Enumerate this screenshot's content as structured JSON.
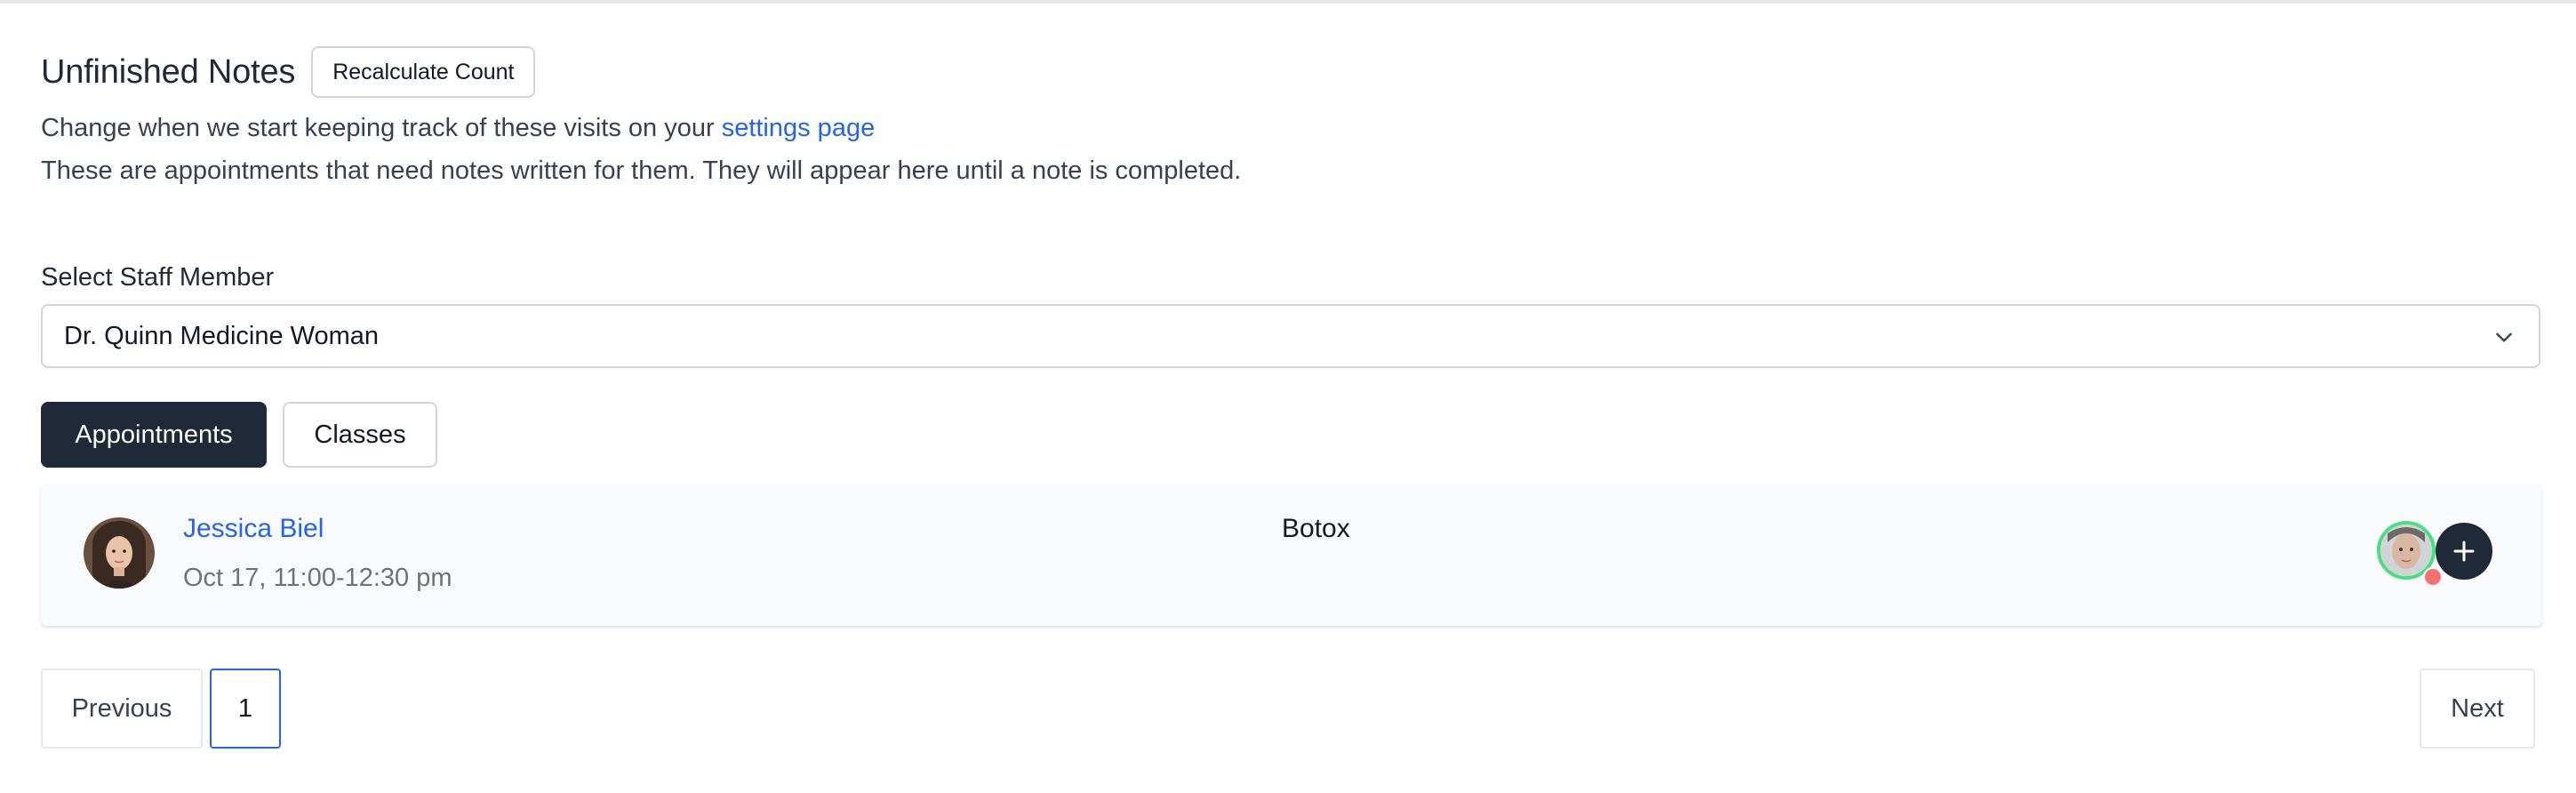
{
  "header": {
    "title": "Unfinished Notes",
    "recalculate_label": "Recalculate Count"
  },
  "description": {
    "line1_prefix": "Change when we start keeping track of these visits on your ",
    "settings_link": "settings page",
    "line2": "These are appointments that need notes written for them. They will appear here until a note is completed."
  },
  "staff_select": {
    "label": "Select Staff Member",
    "value": "Dr. Quinn Medicine Woman"
  },
  "tabs": [
    {
      "label": "Appointments",
      "active": true
    },
    {
      "label": "Classes",
      "active": false
    }
  ],
  "appointments": [
    {
      "client_name": "Jessica Biel",
      "time": "Oct 17, 11:00-12:30 pm",
      "service": "Botox"
    }
  ],
  "pagination": {
    "previous_label": "Previous",
    "current_page": "1",
    "next_label": "Next"
  },
  "colors": {
    "accent": "#2563eb",
    "dark": "#1f2937",
    "status_online": "#4ade80",
    "status_dot": "#f87171"
  }
}
